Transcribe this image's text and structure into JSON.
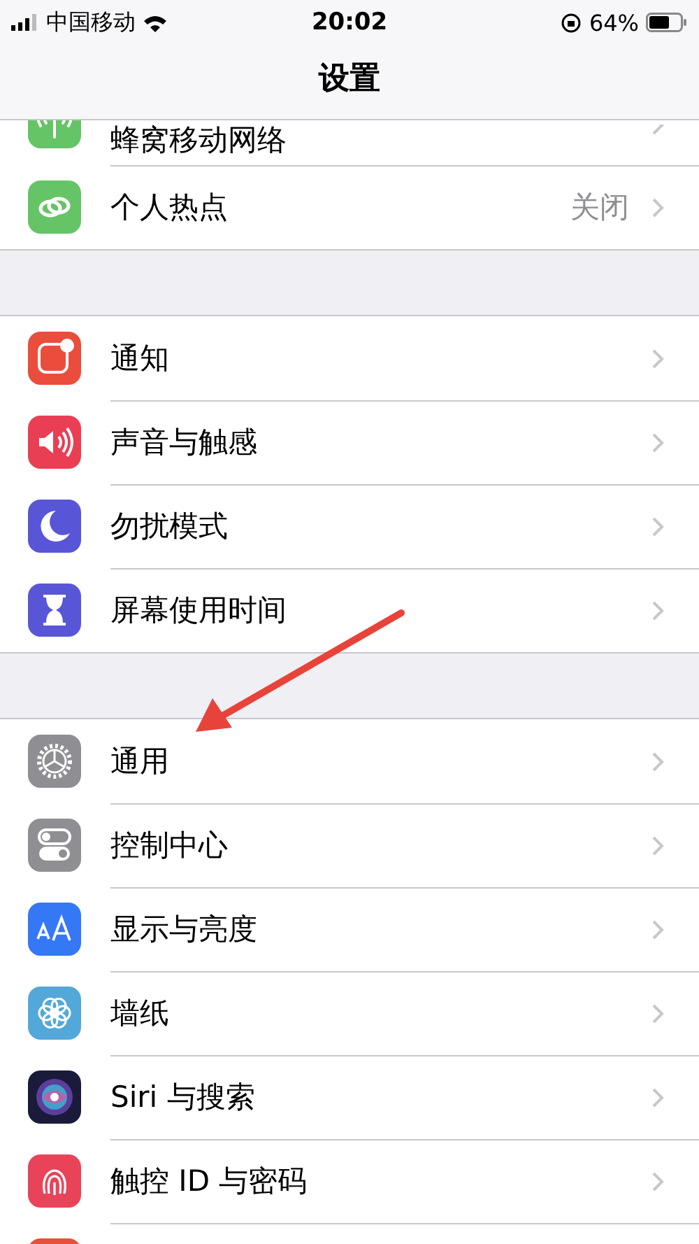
{
  "status_bar": {
    "carrier": "中国移动",
    "time": "20:02",
    "battery": "64%"
  },
  "nav": {
    "title": "设置"
  },
  "groups": [
    {
      "rows": [
        {
          "label": "蜂窝移动网络",
          "color": "#65c466"
        },
        {
          "label": "个人热点",
          "value": "关闭",
          "color": "#65c466"
        }
      ]
    },
    {
      "rows": [
        {
          "label": "通知",
          "color": "#eb4d3d"
        },
        {
          "label": "声音与触感",
          "color": "#ea3e55"
        },
        {
          "label": "勿扰模式",
          "color": "#5856d6"
        },
        {
          "label": "屏幕使用时间",
          "color": "#5856d6"
        }
      ]
    },
    {
      "rows": [
        {
          "label": "通用",
          "color": "#8e8e93"
        },
        {
          "label": "控制中心",
          "color": "#8e8e93"
        },
        {
          "label": "显示与亮度",
          "color": "#3478f6"
        },
        {
          "label": "墙纸",
          "color": "#54a8d9"
        },
        {
          "label": "Siri 与搜索",
          "color": "#1a1a3a"
        },
        {
          "label": "触控 ID 与密码",
          "color": "#e9435a"
        },
        {
          "color": "#e9503a"
        }
      ]
    }
  ]
}
